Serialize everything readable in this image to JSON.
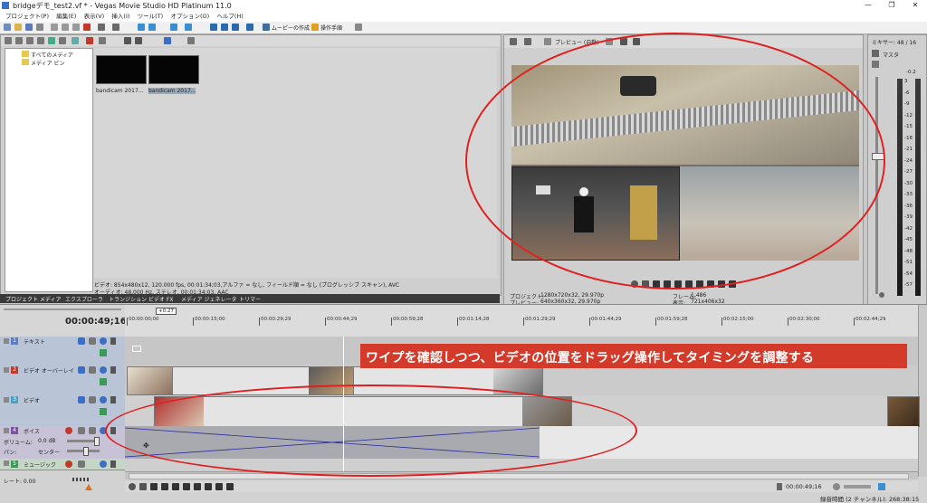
{
  "window": {
    "title": "bridgeデモ_test2.vf * - Vegas Movie Studio HD Platinum 11.0",
    "minimize": "—",
    "restore": "❐",
    "close": "✕"
  },
  "menu": {
    "items": [
      "プロジェクト(P)",
      "編集(E)",
      "表示(V)",
      "挿入(I)",
      "ツール(T)",
      "オプション(O)",
      "ヘルプ(H)"
    ]
  },
  "toolbar": {
    "movie_label": "ムービーの作成",
    "steps_label": "操作手順"
  },
  "explorer": {
    "tree": [
      "すべてのメディア",
      "メディア ビン"
    ],
    "thumbs": [
      "bandicam 2017...",
      "bandicam 2017..."
    ],
    "info_line1": "ビデオ: 854x480x12, 120.000 fps, 00:01:34;03,アルファ = なし, フィールド順 = なし (プログレッシブ スキャン), AVC",
    "info_line2": "オーディオ: 48,000 Hz, ステレオ, 00:01:34;03, AAC"
  },
  "tabs": {
    "items": [
      "プロジェクト メディア",
      "エクスプローラ",
      "トランジション",
      "ビデオ FX",
      "メディア ジェネレータ",
      "トリマー"
    ]
  },
  "preview": {
    "mode": "プレビュー (自動)",
    "project_label": "プロジェクト:",
    "project_value": "1280x720x32, 29.970p",
    "preview_label": "プレビュー:",
    "preview_value": "640x360x32, 29.970p",
    "frame_label": "フレーム:",
    "frame_value": "1,486",
    "display_label": "表示:",
    "display_value": "721x406x32"
  },
  "mixer": {
    "title": "ミキサー: 48 / 16",
    "master": "マスタ",
    "peak": "-0.2",
    "scale": [
      "3",
      "-6",
      "-9",
      "-12",
      "-15",
      "-18",
      "-21",
      "-24",
      "-27",
      "-30",
      "-33",
      "-36",
      "-39",
      "-42",
      "-45",
      "-48",
      "-51",
      "-54",
      "-57"
    ]
  },
  "timeline": {
    "timecode": "00:00:49;16",
    "cursor_badge": "+0:27",
    "ticks": [
      "00:00:00;00",
      "00:00:15;00",
      "00:00:29;29",
      "00:00:44;29",
      "00:00:59;28",
      "00:01:14;28",
      "00:01:29;29",
      "00:01:44;29",
      "00:01:59;28",
      "00:02:15;00",
      "00:02:30;00",
      "00:02:44;29"
    ],
    "tracks": [
      {
        "num": "1",
        "name": "テキスト",
        "color": "#5c7fc0"
      },
      {
        "num": "2",
        "name": "ビデオ オーバーレイ",
        "color": "#c0392b"
      },
      {
        "num": "3",
        "name": "ビデオ",
        "color": "#4aa3c7"
      },
      {
        "num": "4",
        "name": "ボイス",
        "color": "#7b52a8"
      },
      {
        "num": "5",
        "name": "ミュージック",
        "color": "#3f9a58"
      }
    ],
    "volume_label": "ボリューム:",
    "volume_value": "0.0 dB",
    "pan_label": "パン:",
    "pan_value": "センター",
    "rate_label": "レート: 0.00",
    "footer_timecode": "00:00:49;16",
    "record_time": "録音時間 (2 チャンネル): 268:38:15"
  },
  "annotation": {
    "text": "ワイプを確認しつつ、ビデオの位置をドラッグ操作してタイミングを調整する"
  },
  "colors": {
    "accent_red": "#e02020",
    "annotation_bg": "#d43a2a"
  }
}
